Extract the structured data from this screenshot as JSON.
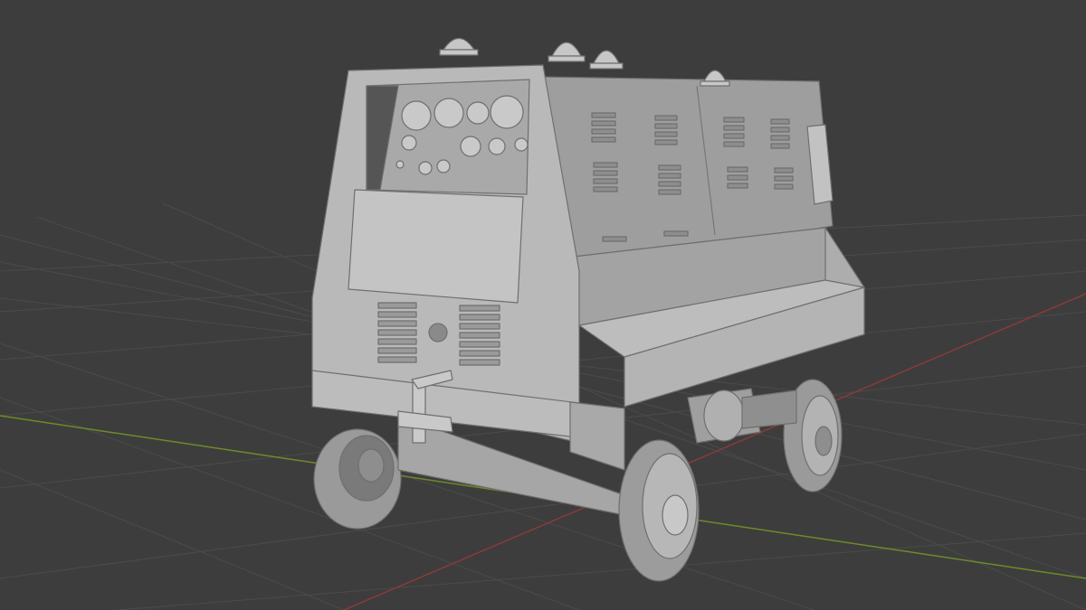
{
  "viewport": {
    "background": "#3d3d3d",
    "grid_color": "#4a4a4a",
    "x_axis_color": "#8a3a3a",
    "y_axis_color": "#6e8a2a",
    "grid_visible": true,
    "shading": "solid-grey"
  },
  "scene": {
    "object": "ground-power-unit-cart",
    "body_color": "#b9b9b9",
    "shadow_color": "#8c8c8c",
    "panel_color": "#9e9e9e",
    "dark_color": "#5c5c5c",
    "tire_color": "#9a9a9a",
    "beacon_count": 4,
    "louver_groups": 10,
    "wheel_count": 4
  }
}
